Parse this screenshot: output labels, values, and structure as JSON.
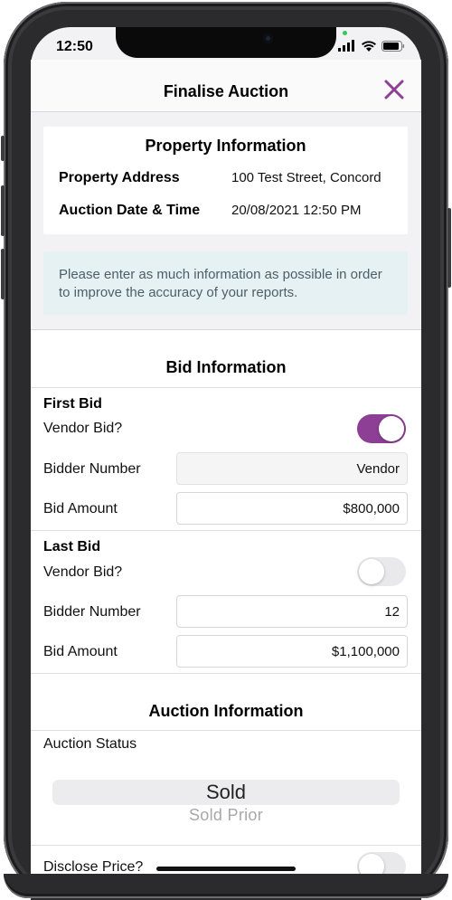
{
  "status_bar": {
    "time": "12:50"
  },
  "header": {
    "title": "Finalise Auction",
    "close_icon": "close-icon"
  },
  "property_info": {
    "title": "Property Information",
    "address_label": "Property Address",
    "address_value": "100 Test Street, Concord",
    "datetime_label": "Auction Date & Time",
    "datetime_value": "20/08/2021 12:50 PM"
  },
  "notice": "Please enter as much information as possible in order to improve the accuracy of your reports.",
  "bid_info": {
    "title": "Bid Information",
    "first_bid": {
      "heading": "First Bid",
      "vendor_label": "Vendor Bid?",
      "vendor_on": true,
      "bidder_label": "Bidder Number",
      "bidder_value": "Vendor",
      "amount_label": "Bid Amount",
      "amount_value": "$800,000"
    },
    "last_bid": {
      "heading": "Last Bid",
      "vendor_label": "Vendor Bid?",
      "vendor_on": false,
      "bidder_label": "Bidder Number",
      "bidder_value": "12",
      "amount_label": "Bid Amount",
      "amount_value": "$1,100,000"
    }
  },
  "auction_info": {
    "title": "Auction Information",
    "status_label": "Auction Status",
    "status_options": [
      "Sold",
      "Sold Prior"
    ],
    "disclose_label": "Disclose Price?",
    "disclose_on": false
  },
  "colors": {
    "accent": "#8C3F94",
    "notice_bg": "#E6F1F3",
    "screen_bg": "#F2F2F4"
  }
}
